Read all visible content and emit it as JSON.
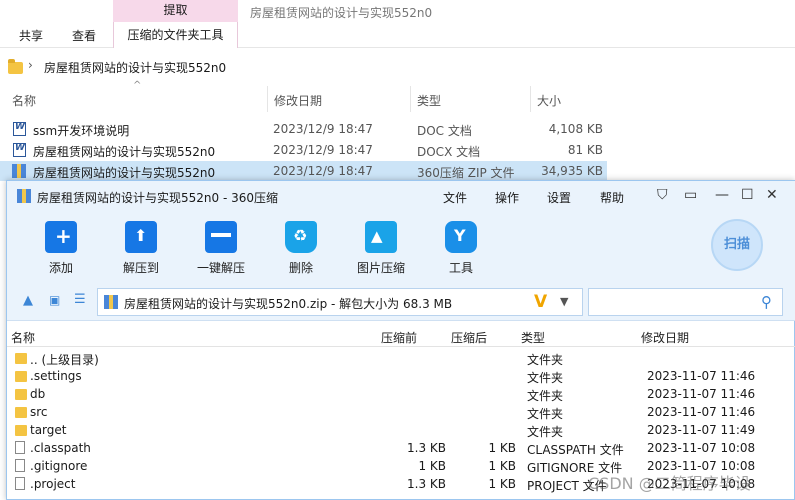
{
  "explorer": {
    "ribbon": {
      "context_tab": "提取",
      "window_title": "房屋租赁网站的设计与实现552n0",
      "tabs": [
        "共享",
        "查看"
      ],
      "tool_tab": "压缩的文件夹工具"
    },
    "address": "房屋租赁网站的设计与实现552n0",
    "columns": {
      "name": "名称",
      "modified": "修改日期",
      "type": "类型",
      "size": "大小"
    },
    "files": [
      {
        "name": "ssm开发环境说明",
        "modified": "2023/12/9 18:47",
        "type": "DOC 文档",
        "size": "4,108 KB"
      },
      {
        "name": "房屋租赁网站的设计与实现552n0",
        "modified": "2023/12/9 18:47",
        "type": "DOCX 文档",
        "size": "81 KB"
      },
      {
        "name": "房屋租赁网站的设计与实现552n0",
        "modified": "2023/12/9 18:47",
        "type": "360压缩 ZIP 文件",
        "size": "34,935 KB"
      }
    ]
  },
  "archive": {
    "title": "房屋租赁网站的设计与实现552n0 - 360压缩",
    "menu": [
      "文件",
      "操作",
      "设置",
      "帮助"
    ],
    "toolbar": [
      "添加",
      "解压到",
      "一键解压",
      "删除",
      "图片压缩",
      "工具"
    ],
    "scan_label": "扫描",
    "path": "房屋租赁网站的设计与实现552n0.zip - 解包大小为 68.3 MB",
    "columns": {
      "name": "名称",
      "compressed": "压缩前",
      "packed": "压缩后",
      "type": "类型",
      "modified": "修改日期"
    },
    "rows": [
      {
        "name": ".. (上级目录)",
        "before": "",
        "after": "",
        "type": "文件夹",
        "modified": "",
        "kind": "folder"
      },
      {
        "name": ".settings",
        "before": "",
        "after": "",
        "type": "文件夹",
        "modified": "2023-11-07 11:46",
        "kind": "folder"
      },
      {
        "name": "db",
        "before": "",
        "after": "",
        "type": "文件夹",
        "modified": "2023-11-07 11:46",
        "kind": "folder"
      },
      {
        "name": "src",
        "before": "",
        "after": "",
        "type": "文件夹",
        "modified": "2023-11-07 11:46",
        "kind": "folder"
      },
      {
        "name": "target",
        "before": "",
        "after": "",
        "type": "文件夹",
        "modified": "2023-11-07 11:49",
        "kind": "folder"
      },
      {
        "name": ".classpath",
        "before": "1.3 KB",
        "after": "1 KB",
        "type": "CLASSPATH 文件",
        "modified": "2023-11-07 10:08",
        "kind": "file"
      },
      {
        "name": ".gitignore",
        "before": "1 KB",
        "after": "1 KB",
        "type": "GITIGNORE 文件",
        "modified": "2023-11-07 10:08",
        "kind": "file"
      },
      {
        "name": ".project",
        "before": "1.3 KB",
        "after": "1 KB",
        "type": "PROJECT 文件",
        "modified": "2023-11-07 10:08",
        "kind": "file"
      }
    ]
  },
  "watermark": "CSDN @二简程序毕设",
  "colors": {
    "accent": "#1677e5",
    "selection": "#cce4f7",
    "window_bg": "#eaf3fc",
    "context_tab": "#f7d9ea"
  }
}
